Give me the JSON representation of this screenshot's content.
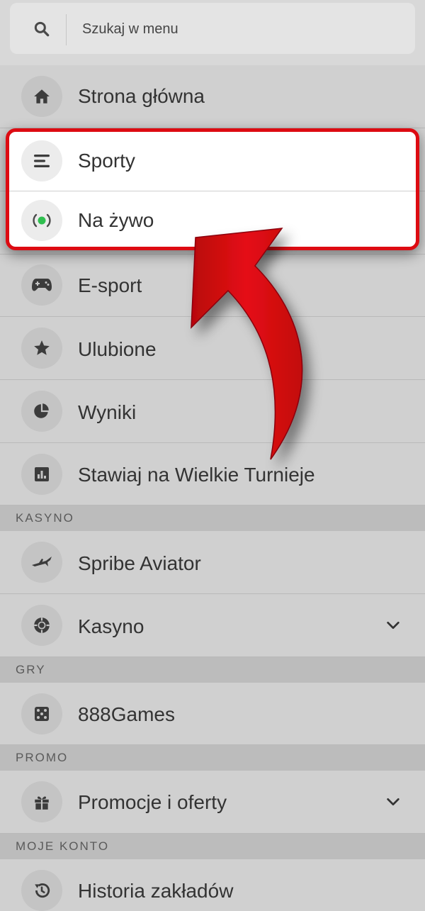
{
  "search": {
    "placeholder": "Szukaj w menu"
  },
  "menu": {
    "home": "Strona główna",
    "sports": "Sporty",
    "live": "Na żywo",
    "esport": "E-sport",
    "favorites": "Ulubione",
    "results": "Wyniki",
    "tournaments": "Stawiaj na Wielkie Turnieje"
  },
  "sections": {
    "casino": {
      "header": "KASYNO",
      "items": [
        "Spribe Aviator",
        "Kasyno"
      ]
    },
    "games": {
      "header": "GRY",
      "items": [
        "888Games"
      ]
    },
    "promo": {
      "header": "PROMO",
      "items": [
        "Promocje i oferty"
      ]
    },
    "account": {
      "header": "MOJE KONTO",
      "items": [
        "Historia zakładów"
      ]
    }
  },
  "colors": {
    "highlight_border": "#dd0b12",
    "live_dot": "#2fbf4f",
    "arrow": "#d9080f"
  }
}
